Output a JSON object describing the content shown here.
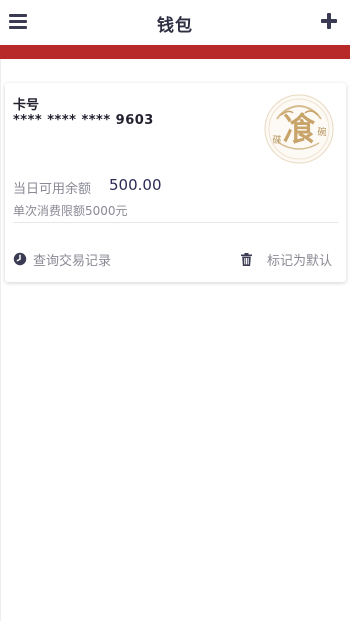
{
  "header": {
    "title": "钱包",
    "menu_icon": "hamburger-menu-icon",
    "add_icon": "plus-icon"
  },
  "colors": {
    "accent_red": "#b82a2a",
    "header_text": "#2f2f44",
    "amount_text": "#2b2b55",
    "logo_gold": "#c9a46a"
  },
  "card": {
    "label": "卡号",
    "number": "**** **** **** 9603",
    "logo": {
      "main_char": "飡",
      "left_char": "碟",
      "right_char": "碗"
    },
    "available": {
      "label": "当日可用余额",
      "value": "500.00"
    },
    "limit_text": "单次消费限额5000元",
    "actions": {
      "history": {
        "icon": "clock-icon",
        "label": "查询交易记录"
      },
      "default": {
        "icon": "trash-icon",
        "label": "标记为默认"
      }
    }
  }
}
